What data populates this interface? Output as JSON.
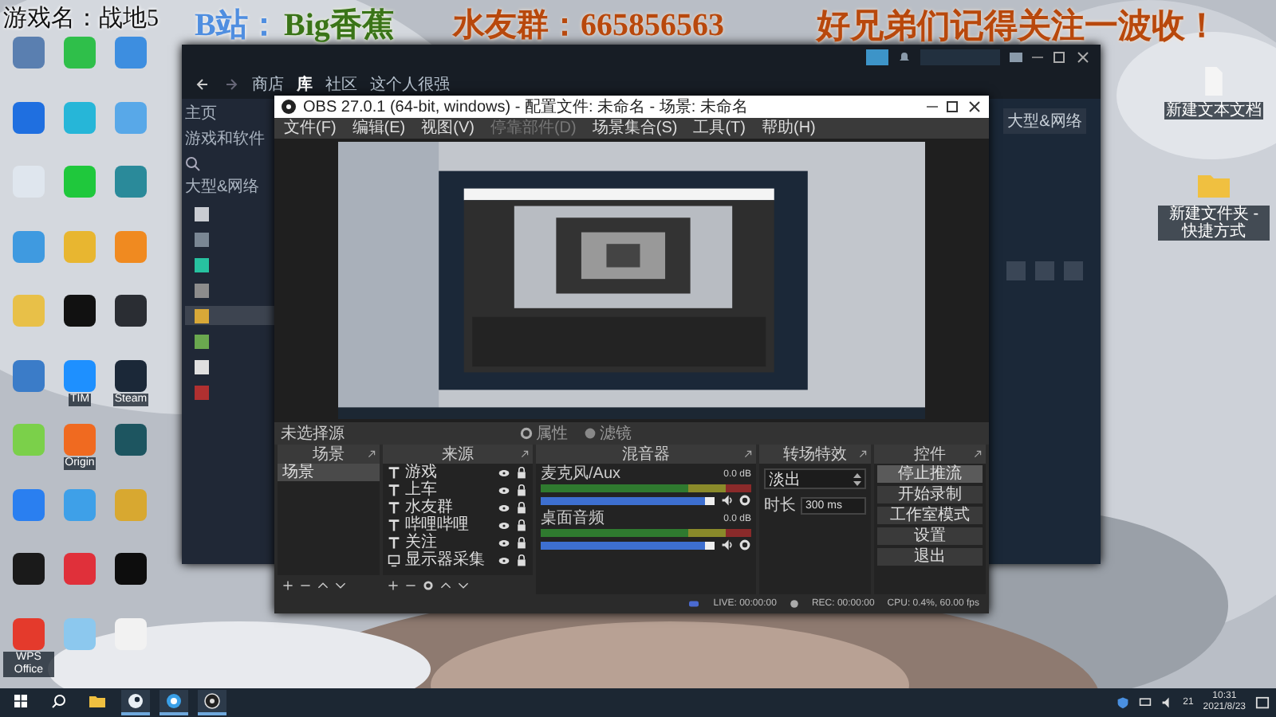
{
  "overlay": [
    {
      "kind": "game",
      "text": "游戏名：战地5"
    },
    {
      "kind": "bili_label",
      "text": "B站："
    },
    {
      "kind": "bili_name",
      "text": "Big香蕉"
    },
    {
      "kind": "group",
      "text": "水友群：665856563"
    },
    {
      "kind": "slogan",
      "text": "好兄弟们记得关注一波收！"
    }
  ],
  "desktop_icons": [
    {
      "color": "#5a7fb0"
    },
    {
      "color": "#2fbf4a"
    },
    {
      "color": "#3d8ee0"
    },
    {
      "color": "#1f6fe0"
    },
    {
      "color": "#26b6d8"
    },
    {
      "color": "#58a8e8"
    },
    {
      "color": "#dfe6ee"
    },
    {
      "color": "#1fc83c"
    },
    {
      "color": "#2a8a9a"
    },
    {
      "color": "#3f9ae0"
    },
    {
      "color": "#e8b630"
    },
    {
      "color": "#f08a20"
    },
    {
      "color": "#e8c048"
    },
    {
      "color": "#111111"
    },
    {
      "color": "#2a2d33"
    },
    {
      "color": "#3b7cc8"
    },
    {
      "color": "#1e90ff",
      "label": "TIM"
    },
    {
      "color": "#1b2838",
      "label": "Steam"
    },
    {
      "color": "#7bd04a"
    },
    {
      "color": "#f06a20",
      "label": "Origin"
    },
    {
      "color": "#1d5560"
    },
    {
      "color": "#2a7ff0"
    },
    {
      "color": "#3ea0e8"
    },
    {
      "color": "#d8a830"
    },
    {
      "color": "#1a1a1a"
    },
    {
      "color": "#e0303a"
    },
    {
      "color": "#0d0d0d"
    },
    {
      "color": "#e43a2c",
      "label": "WPS Office"
    },
    {
      "color": "#8cc8ee"
    },
    {
      "color": "#f2f2f2"
    }
  ],
  "right_icons": [
    {
      "kind": "file",
      "label": "新建文本文档"
    },
    {
      "kind": "folder",
      "label": "新建文件夹 - 快捷方式"
    }
  ],
  "steam": {
    "nav": [
      {
        "label": "商店",
        "selected": false
      },
      {
        "label": "库",
        "selected": true
      },
      {
        "label": "社区",
        "selected": false
      },
      {
        "label": "这个人很强",
        "selected": false
      }
    ],
    "home": "主页",
    "games": "游戏和软件",
    "category": "大型&网络",
    "games_list": [
      {
        "color": "#c9ccd2",
        "selected": false
      },
      {
        "color": "#7a8794",
        "selected": false
      },
      {
        "color": "#27c2a0",
        "selected": false
      },
      {
        "color": "#8c8c8c",
        "selected": false
      },
      {
        "color": "#d8a838",
        "selected": true
      },
      {
        "color": "#6aa84f",
        "selected": false
      },
      {
        "color": "#e0e0e0",
        "selected": false
      },
      {
        "color": "#b03030",
        "selected": false
      }
    ],
    "right_button": "大型&网络"
  },
  "obs": {
    "title": "OBS 27.0.1 (64-bit, windows) - 配置文件: 未命名 - 场景: 未命名",
    "menu": [
      {
        "label": "文件(F)",
        "disabled": false
      },
      {
        "label": "编辑(E)",
        "disabled": false
      },
      {
        "label": "视图(V)",
        "disabled": false
      },
      {
        "label": "停靠部件(D)",
        "disabled": true
      },
      {
        "label": "场景集合(S)",
        "disabled": false
      },
      {
        "label": "工具(T)",
        "disabled": false
      },
      {
        "label": "帮助(H)",
        "disabled": false
      }
    ],
    "source_status": "未选择源",
    "source_buttons": [
      {
        "kind": "properties",
        "label": "属性"
      },
      {
        "kind": "filters",
        "label": "滤镜"
      }
    ],
    "scenes": {
      "title": "场景",
      "items": [
        {
          "label": "场景",
          "selected": true
        }
      ]
    },
    "sources": {
      "title": "来源",
      "items": [
        {
          "kind": "text",
          "label": "游戏"
        },
        {
          "kind": "text",
          "label": "上车"
        },
        {
          "kind": "text",
          "label": "水友群"
        },
        {
          "kind": "text",
          "label": "哔哩哔哩"
        },
        {
          "kind": "text",
          "label": "关注"
        },
        {
          "kind": "display",
          "label": "显示器采集"
        }
      ]
    },
    "mixer": {
      "title": "混音器",
      "channels": [
        {
          "name": "麦克风/Aux",
          "reading": "0.0 dB",
          "level": 0.94
        },
        {
          "name": "桌面音频",
          "reading": "0.0 dB",
          "level": 0.94
        }
      ]
    },
    "transitions": {
      "title": "转场特效",
      "value": "淡出",
      "duration_label": "时长",
      "duration": "300 ms"
    },
    "controls": {
      "title": "控件",
      "buttons": [
        {
          "label": "停止推流",
          "active": true
        },
        {
          "label": "开始录制",
          "active": false
        },
        {
          "label": "工作室模式",
          "active": false
        },
        {
          "label": "设置",
          "active": false
        },
        {
          "label": "退出",
          "active": false
        }
      ]
    },
    "status": {
      "live": "LIVE: 00:00:00",
      "rec": "REC: 00:00:00",
      "cpu": "CPU: 0.4%, 60.00 fps"
    }
  },
  "taskbar": {
    "apps": [
      {
        "kind": "start",
        "open": false
      },
      {
        "kind": "search",
        "open": false
      },
      {
        "kind": "folder",
        "open": false
      },
      {
        "kind": "steam",
        "open": true
      },
      {
        "kind": "browser",
        "open": true
      },
      {
        "kind": "obs",
        "open": true
      }
    ],
    "ime": "21",
    "time": "10:31",
    "date": "2021/8/23"
  }
}
